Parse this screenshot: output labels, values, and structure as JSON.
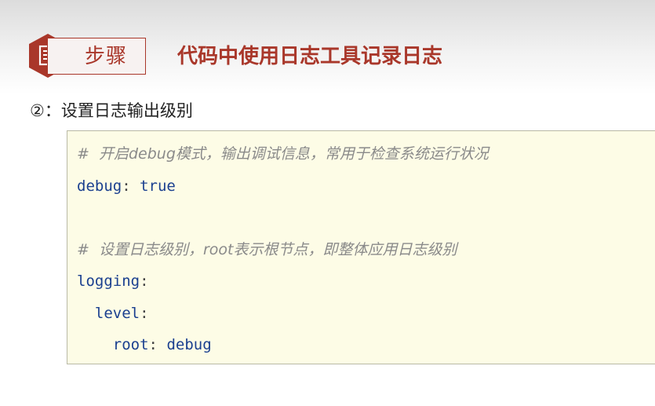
{
  "header": {
    "step_label": "步骤",
    "title": "代码中使用日志工具记录日志",
    "icon": "document-icon",
    "accent_color": "#a9372a"
  },
  "subtitle": "②：设置日志输出级别",
  "code": {
    "comment1": "#  开启debug模式，输出调试信息，常用于检查系统运行状况",
    "line2_key": "debug",
    "line2_val": "true",
    "comment2": "#  设置日志级别，root表示根节点，即整体应用日志级别",
    "line4_key": "logging",
    "line5_key": "level",
    "line6_key": "root",
    "line6_val": "debug",
    "colon": ":"
  }
}
